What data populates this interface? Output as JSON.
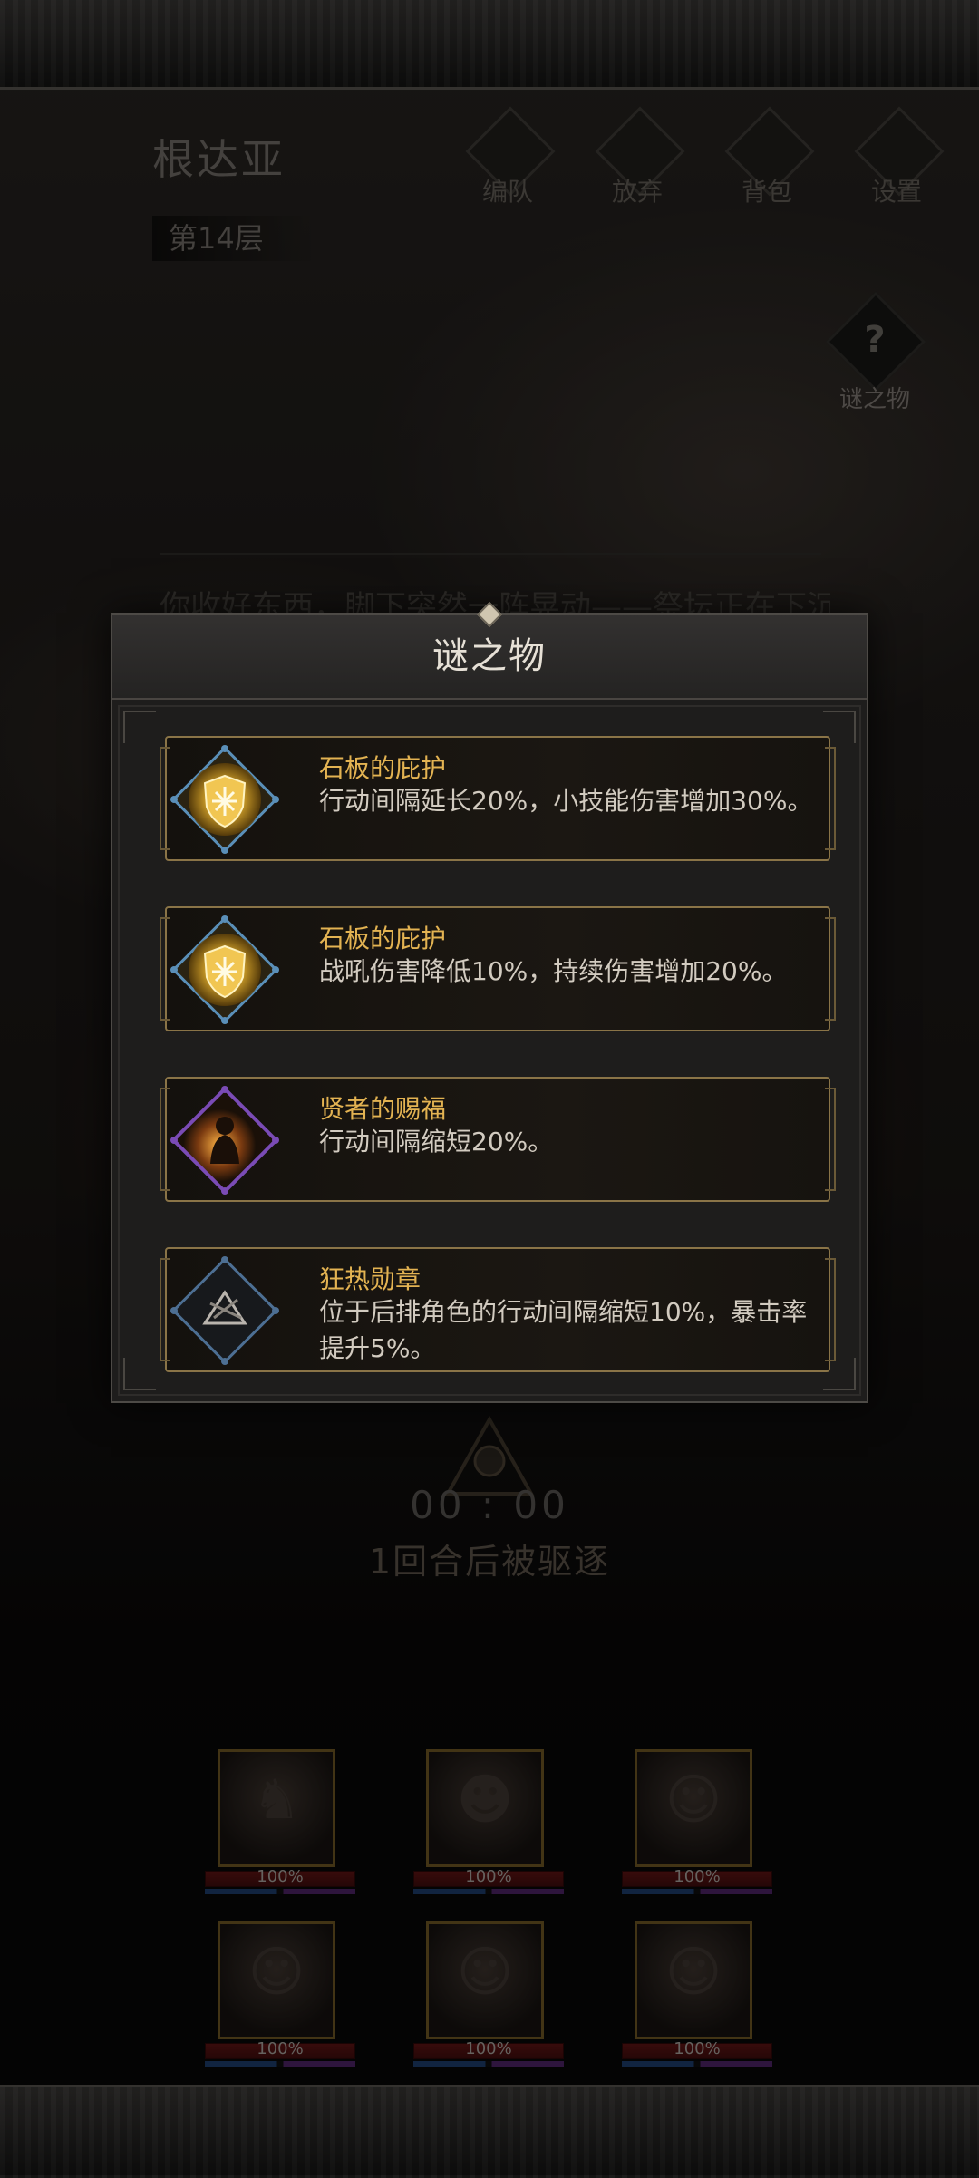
{
  "header": {
    "level_name": "根达亚",
    "floor": "第14层",
    "menu": [
      {
        "label": "编队",
        "icon": "team-icon"
      },
      {
        "label": "放弃",
        "icon": "flag-icon"
      },
      {
        "label": "背包",
        "icon": "bag-icon"
      },
      {
        "label": "设置",
        "icon": "gear-icon"
      }
    ],
    "mystery_button": {
      "label": "谜之物",
      "icon": "question-icon"
    }
  },
  "story": {
    "text": "你收好东西，脚下突然一阵晃动——祭坛正在下沉"
  },
  "modal": {
    "title": "谜之物",
    "items": [
      {
        "name": "石板的庇护",
        "desc": "行动间隔延长20%，小技能伤害增加30%。",
        "icon": "stone-shield-icon",
        "rarity_color": "#5a8fb8"
      },
      {
        "name": "石板的庇护",
        "desc": "战吼伤害降低10%，持续伤害增加20%。",
        "icon": "stone-shield-icon",
        "rarity_color": "#5a8fb8"
      },
      {
        "name": "贤者的赐福",
        "desc": "行动间隔缩短20%。",
        "icon": "sage-blessing-icon",
        "rarity_color": "#7a4bb5"
      },
      {
        "name": "狂热勋章",
        "desc": "位于后排角色的行动间隔缩短10%，暴击率提升5%。",
        "icon": "fervor-medal-icon",
        "rarity_color": "#4d6f93"
      }
    ]
  },
  "timer": {
    "time": "00 : 00",
    "expel_text": "1回合后被驱逐"
  },
  "party": [
    {
      "hp": "100%",
      "portrait": "dragon-portrait-icon",
      "hp_fraction": 1.0
    },
    {
      "hp": "100%",
      "portrait": "warrior-portrait-icon",
      "hp_fraction": 1.0
    },
    {
      "hp": "100%",
      "portrait": "elf-portrait-icon",
      "hp_fraction": 1.0
    },
    {
      "hp": "100%",
      "portrait": "redhair-portrait-icon",
      "hp_fraction": 1.0
    },
    {
      "hp": "100%",
      "portrait": "sorceress-portrait-icon",
      "hp_fraction": 1.0
    },
    {
      "hp": "100%",
      "portrait": "mage-portrait-icon",
      "hp_fraction": 1.0
    }
  ],
  "colors": {
    "accent_gold": "#e3b352",
    "item_border": "#8a7447",
    "hp_red": "#5b1313",
    "mp_blue": "#1c3a68",
    "mp_purple": "#4b2363"
  }
}
